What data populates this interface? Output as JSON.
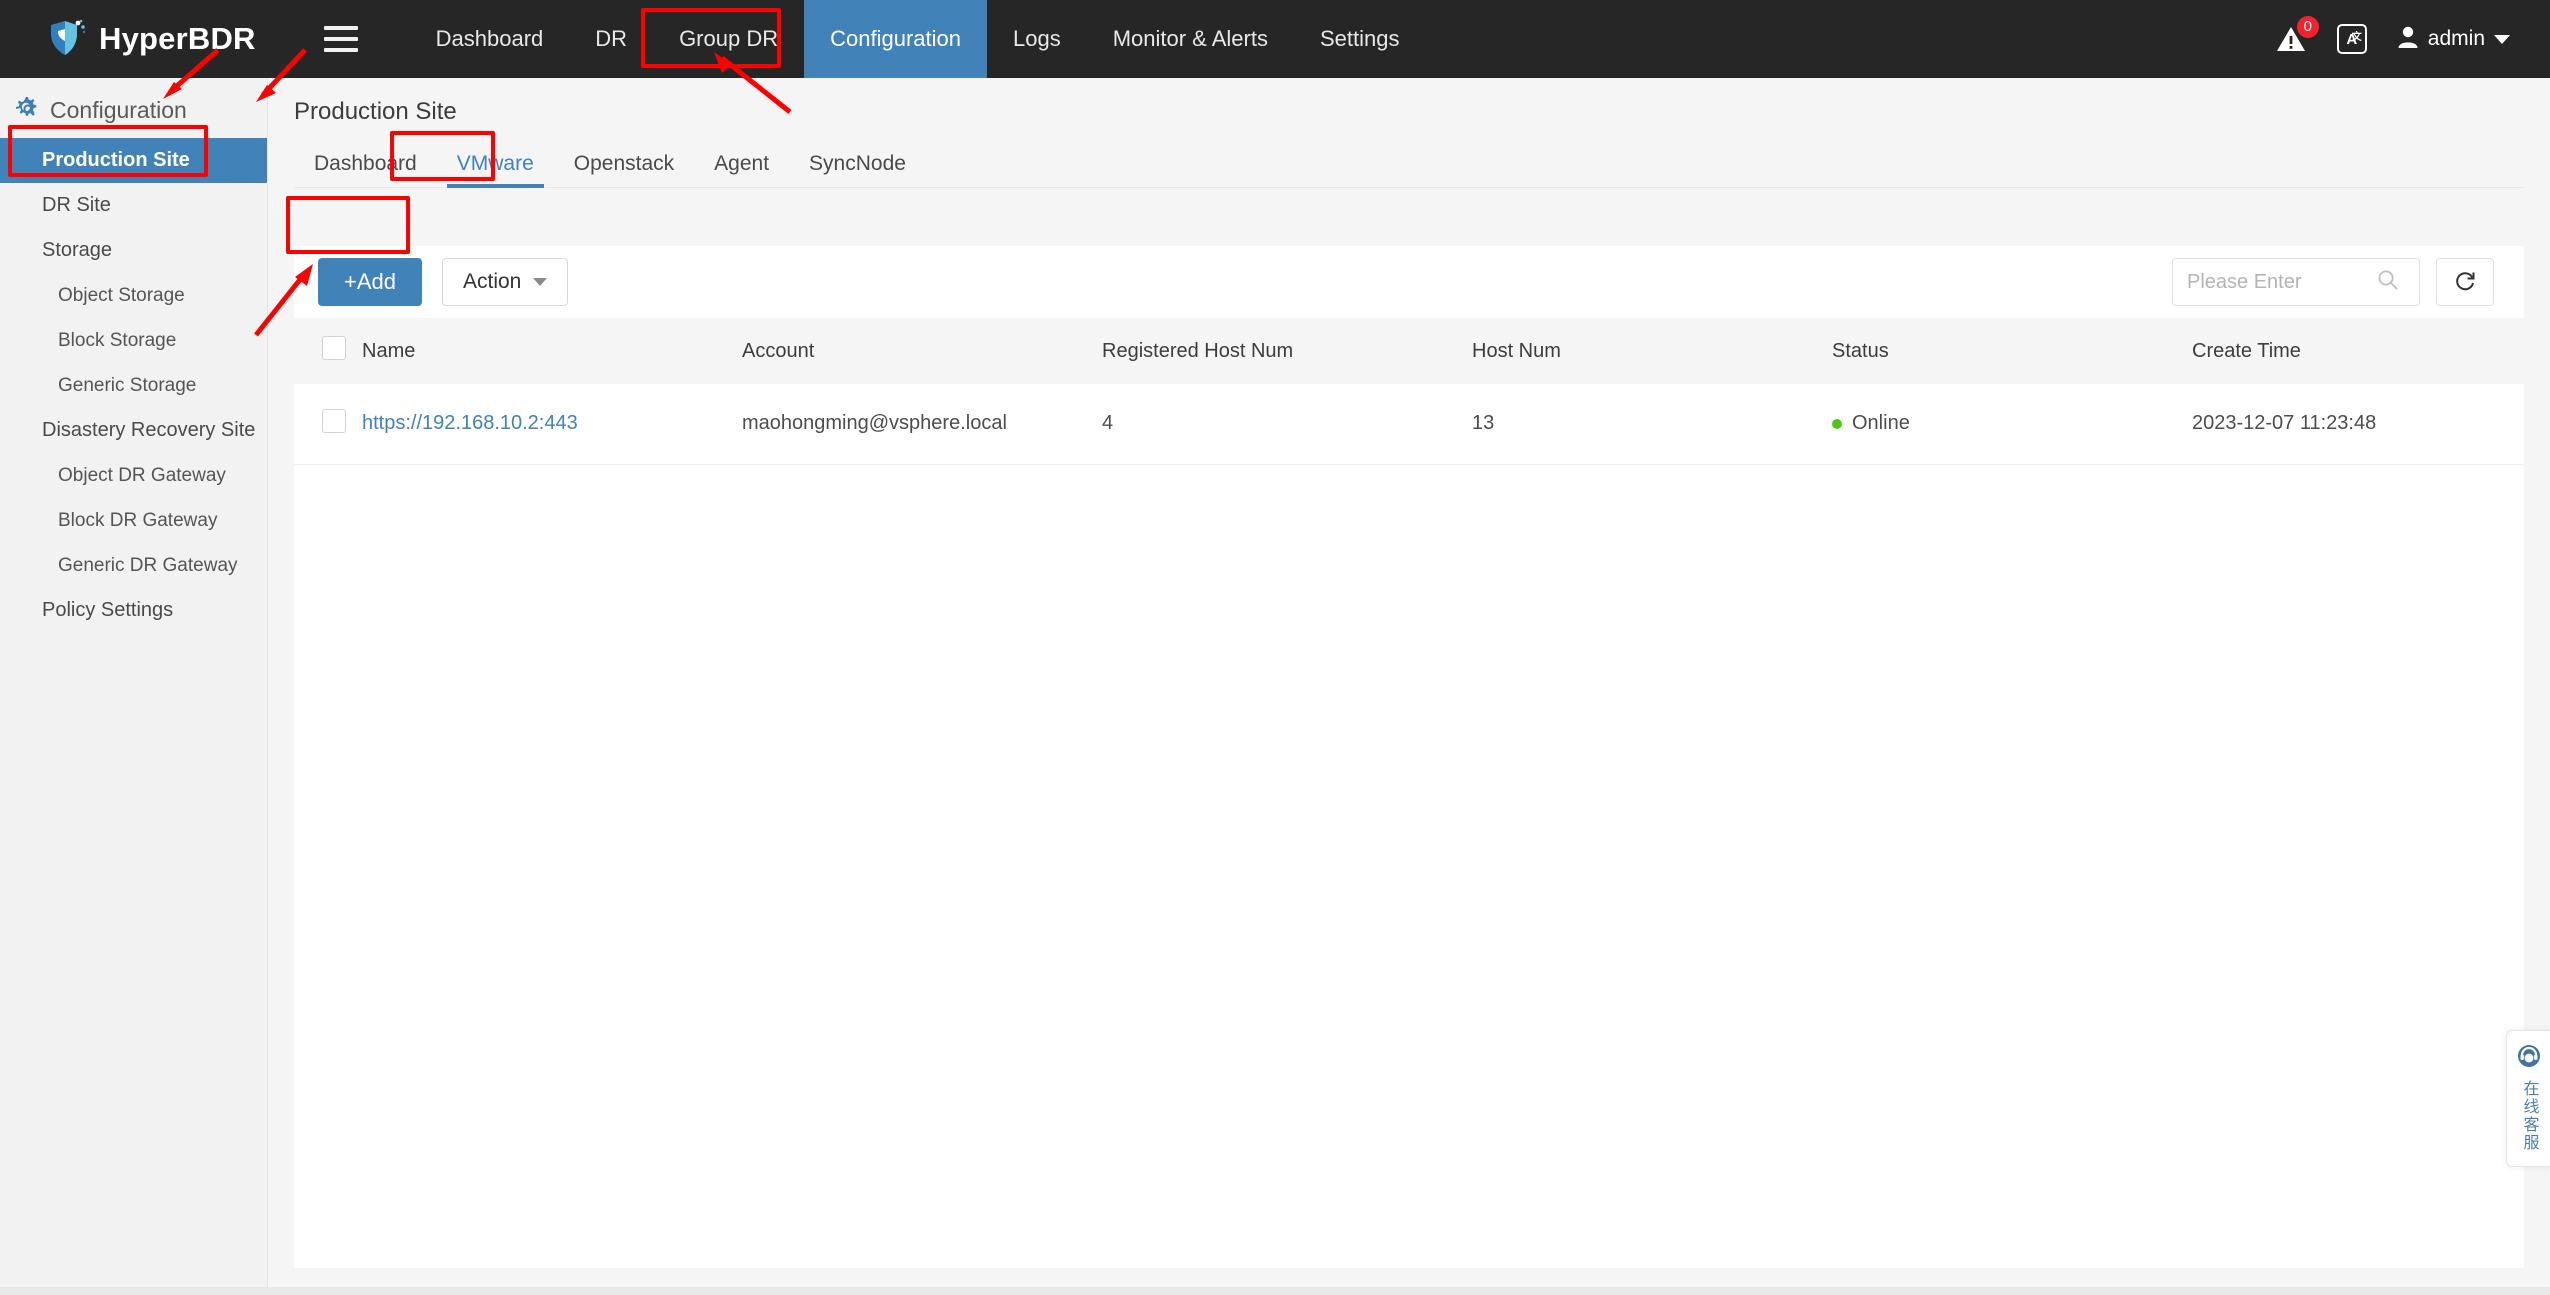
{
  "app": {
    "brand": "HyperBDR",
    "logo_colors": {
      "dark_blue": "#2f7fc1",
      "light_blue": "#64c3e0"
    }
  },
  "topnav": {
    "menu_icon": "hamburger-icon",
    "items": [
      {
        "label": "Dashboard",
        "active": false
      },
      {
        "label": "DR",
        "active": false
      },
      {
        "label": "Group DR",
        "active": false
      },
      {
        "label": "Configuration",
        "active": true
      },
      {
        "label": "Logs",
        "active": false
      },
      {
        "label": "Monitor & Alerts",
        "active": false
      },
      {
        "label": "Settings",
        "active": false
      }
    ],
    "active_color": "#4182b8"
  },
  "topbar_right": {
    "alert_icon": "warning-triangle-icon",
    "alert_count": "0",
    "alert_badge_color": "#f5222d",
    "language_icon": "translate-icon",
    "language_glyph": "A",
    "language_sup": "文",
    "user_icon": "user-avatar-icon",
    "user_name": "admin",
    "dropdown_icon": "chevron-down-icon"
  },
  "sidebar": {
    "header_icon": "gear-search-icon",
    "header": "Configuration",
    "items": [
      {
        "label": "Production Site",
        "level": 1,
        "active": true
      },
      {
        "label": "DR Site",
        "level": 1,
        "active": false
      },
      {
        "label": "Storage",
        "level": 1,
        "active": false
      },
      {
        "label": "Object Storage",
        "level": 2,
        "active": false
      },
      {
        "label": "Block Storage",
        "level": 2,
        "active": false
      },
      {
        "label": "Generic Storage",
        "level": 2,
        "active": false
      },
      {
        "label": "Disastery Recovery Site",
        "level": 1,
        "active": false
      },
      {
        "label": "Object DR Gateway",
        "level": 2,
        "active": false
      },
      {
        "label": "Block DR Gateway",
        "level": 2,
        "active": false
      },
      {
        "label": "Generic DR Gateway",
        "level": 2,
        "active": false
      },
      {
        "label": "Policy Settings",
        "level": 1,
        "active": false
      }
    ]
  },
  "main": {
    "page_title": "Production Site",
    "tabs": [
      {
        "label": "Dashboard",
        "active": false
      },
      {
        "label": "VMware",
        "active": true
      },
      {
        "label": "Openstack",
        "active": false
      },
      {
        "label": "Agent",
        "active": false
      },
      {
        "label": "SyncNode",
        "active": false
      }
    ],
    "toolbar": {
      "add_label": "+Add",
      "action_label": "Action",
      "action_caret_icon": "chevron-down-icon",
      "search_placeholder": "Please Enter",
      "search_value": "",
      "search_icon": "search-icon",
      "refresh_icon": "refresh-icon"
    },
    "table": {
      "select_all_checkbox": "unchecked",
      "columns": [
        "Name",
        "Account",
        "Registered Host Num",
        "Host Num",
        "Status",
        "Create Time"
      ],
      "rows": [
        {
          "checkbox": "unchecked",
          "name": "https://192.168.10.2:443",
          "account": "maohongming@vsphere.local",
          "registered_host_num": "4",
          "host_num": "13",
          "status": "Online",
          "status_color": "#52c41a",
          "create_time": "2023-12-07 11:23:48"
        }
      ]
    }
  },
  "service_widget": {
    "icon": "headset-support-icon",
    "label": "在线客服"
  },
  "annotations": {
    "highlight_color": "#ff0000",
    "boxes": [
      "configuration-topnav-box",
      "production-site-sidebar-box",
      "vmware-tab-box",
      "add-button-box"
    ],
    "arrows": [
      "arrow-to-configuration-sidebar",
      "arrow-to-vmware-tab",
      "arrow-to-configuration-topnav",
      "arrow-to-add-button"
    ]
  }
}
